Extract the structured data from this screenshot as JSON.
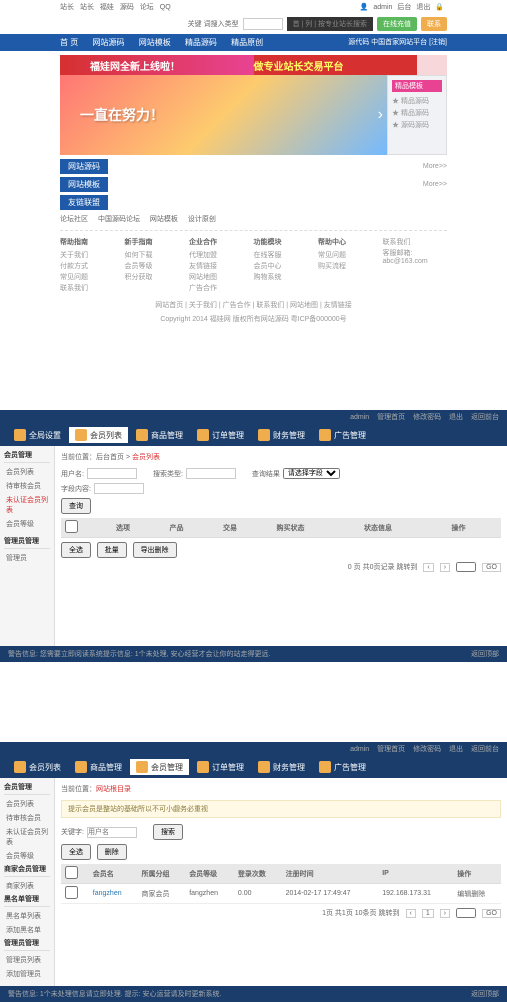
{
  "section1": {
    "topbar": {
      "left": [
        "站长",
        "站长",
        "福娃",
        "源码",
        "论坛",
        "QQ"
      ],
      "right_user": "admin",
      "right_links": [
        "后台",
        "退出"
      ]
    },
    "loginbar": {
      "label": "关键 词搜入类型",
      "dark": "首 | 列 | 按专业站长搜索",
      "btn1": "在线充值",
      "btn2": "联系"
    },
    "nav": {
      "items": [
        "首 页",
        "网站源码",
        "网站模板",
        "精品源码",
        "精品原创"
      ],
      "right": "源代码 中国首家网站平台 [注销]"
    },
    "banner": {
      "top_left": "福娃网全新上线啦！",
      "top_right": "做专业站长交易平台",
      "hero": "一直在努力！",
      "sidebar_title": "精品模板",
      "sidebar_items": [
        "★ 精品源码",
        "★ 精品源码",
        "★ 源码源码"
      ]
    },
    "bars": [
      {
        "label": "网站源码",
        "more": "More>>"
      },
      {
        "label": "网站模板",
        "more": "More>>"
      },
      {
        "label": "友链联盟",
        "more": ""
      }
    ],
    "smalllinks": [
      "论坛社区",
      "中国源码论坛",
      "网站模板",
      "设计原创"
    ],
    "footer_cols": [
      {
        "title": "帮助指南",
        "items": [
          "关于我们",
          "付款方式",
          "常见问题",
          "联系我们"
        ]
      },
      {
        "title": "新手指南",
        "items": [
          "如何下载",
          "会员等级",
          "积分获取"
        ]
      },
      {
        "title": "企业合作",
        "items": [
          "代理加盟",
          "友情链接",
          "网站地图",
          "广告合作"
        ]
      },
      {
        "title": "功能模块",
        "items": [
          "在线客服",
          "会员中心",
          "购物系统"
        ]
      },
      {
        "title": "帮助中心",
        "items": [
          "常见问题",
          "购买流程"
        ]
      },
      {
        "title": "",
        "items": [
          "联系我们",
          "客服邮箱: abc@163.com"
        ]
      }
    ],
    "footer_links": "网站首页 | 关于我们 | 广告合作 | 联系我们 | 网站地图 | 友情链接",
    "footer_copy": "Copyright 2014 福娃网 版权所有网站源码 粤ICP备000000号"
  },
  "section2": {
    "header": {
      "user": "admin",
      "links": [
        "管理首页",
        "修改密码",
        "退出",
        "返回前台"
      ]
    },
    "tabs": [
      "全局设置",
      "会员列表",
      "商品管理",
      "订单管理",
      "财务管理",
      "广告管理"
    ],
    "active_tab": 1,
    "sidebar": {
      "title": "会员管理",
      "items": [
        "会员列表",
        "待审核会员",
        "未认证会员列表",
        "会员等级"
      ],
      "active": 2,
      "title2": "管理员管理",
      "items2": [
        "管理员"
      ]
    },
    "breadcrumb": {
      "parts": [
        "当前位置：后台首页",
        "会员列表"
      ]
    },
    "form": {
      "user_label": "用户名:",
      "search_label": "搜索类型:",
      "result_label": "查询结果",
      "select_opts": [
        "请选择字段"
      ],
      "field_label": "字段内容:",
      "btn": "查询"
    },
    "table": {
      "headers": [
        "",
        "选项",
        "产品",
        "交易",
        "购买状态",
        "状态信息",
        "操作"
      ]
    },
    "pager": {
      "info": "0 页 共0页记录 跳转到",
      "btns": [
        "‹",
        "›"
      ],
      "go": "GO"
    },
    "actions": [
      "全选",
      "批量",
      "导出删除"
    ],
    "footer_left": "警告信息: 您需要立即阅读系统提示信息: 1个未处理, 安心经营才会让你的站走得更远.",
    "footer_right": "返回顶部"
  },
  "section3": {
    "header": {
      "user": "admin",
      "links": [
        "管理首页",
        "修改密码",
        "退出",
        "返回前台"
      ]
    },
    "tabs": [
      "会员列表",
      "商品管理",
      "会员管理",
      "订单管理",
      "财务管理",
      "广告管理"
    ],
    "active_tab": 2,
    "sidebar": {
      "groups": [
        {
          "title": "会员管理",
          "items": [
            "会员列表",
            "待审核会员",
            "未认证会员列表",
            "会员等级"
          ]
        },
        {
          "title": "商家会员管理",
          "items": [
            "商家列表"
          ]
        },
        {
          "title": "黑名单管理",
          "items": [
            "黑名单列表",
            "添加黑名单"
          ]
        },
        {
          "title": "管理员管理",
          "items": [
            "管理员列表",
            "添加管理员"
          ]
        }
      ]
    },
    "breadcrumb": {
      "parts": [
        "当前位置：",
        "网站根目录"
      ]
    },
    "notice": "提示会员是整站的基础所以不可小觑务必重视",
    "form": {
      "label": "关键字:",
      "placeholder": "用户名",
      "btn": "搜索"
    },
    "table": {
      "headers": [
        "",
        "会员名",
        "所属分组",
        "会员等级",
        "登录次数",
        "注册时间",
        "IP",
        "操作"
      ],
      "rows": [
        {
          "name": "fangzhen",
          "group": "商家会员",
          "level": "fangzhen",
          "logins": "0.00",
          "reg": "2014-02-17 17:49:47",
          "ip": "192.168.173.31",
          "ops": "编辑删除"
        }
      ]
    },
    "pager": {
      "info": "1页 共1页  10条页 跳转到",
      "btns": [
        "‹",
        "1",
        "›"
      ],
      "go": "GO"
    },
    "actions": [
      "全选",
      "删除"
    ],
    "footer_left": "警告信息: 1个未处理信息请立即处理. 提示: 安心运营请及时更新系统.",
    "footer_right": "返回顶部"
  }
}
